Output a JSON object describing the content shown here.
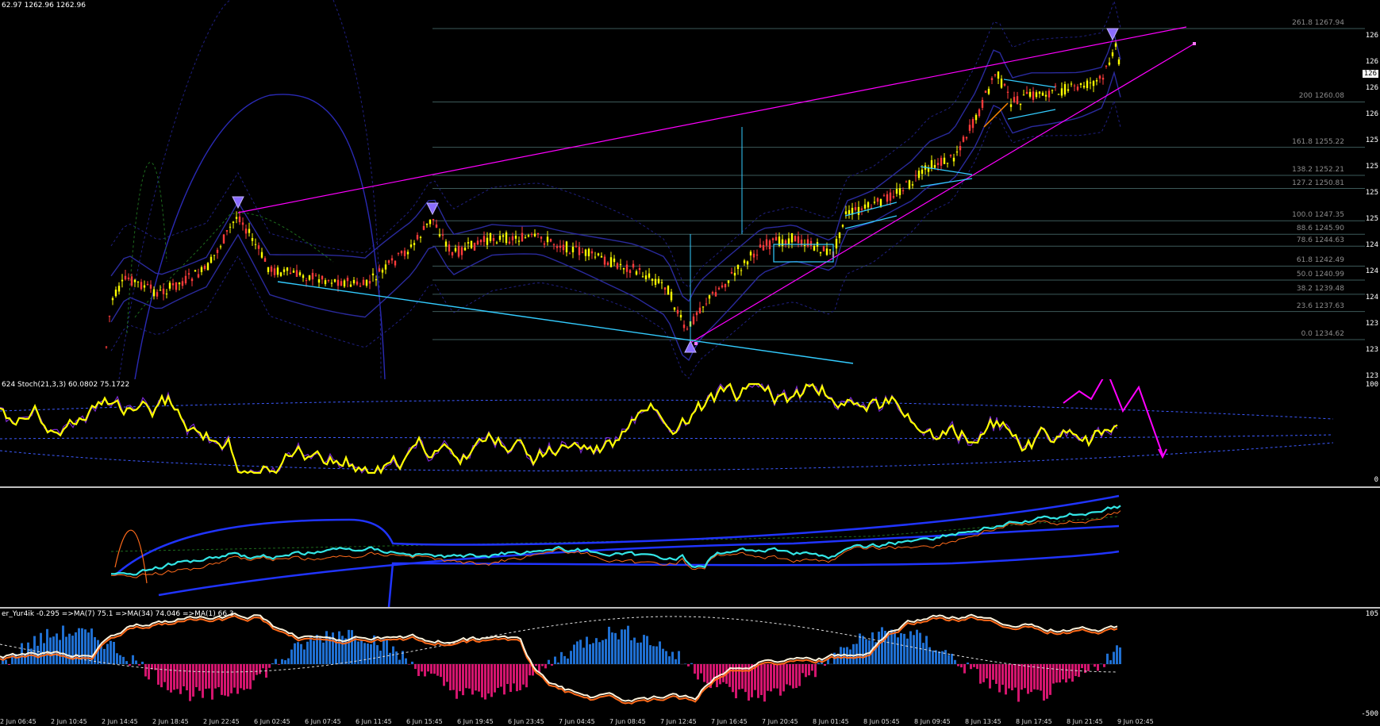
{
  "main": {
    "ohlc": "62.97 1262.96 1262.96",
    "price_axis": [
      "126",
      "126",
      "126",
      "126",
      "125",
      "125",
      "125",
      "125",
      "124",
      "124",
      "124",
      "123",
      "123",
      "123",
      "123"
    ],
    "current_price": "126",
    "fib_levels": [
      {
        "label": "261.8 1267.94",
        "price": 1267.94
      },
      {
        "label": "200 1260.08",
        "price": 1260.08
      },
      {
        "label": "161.8 1255.22",
        "price": 1255.22
      },
      {
        "label": "138.2 1252.21",
        "price": 1252.21
      },
      {
        "label": "127.2 1250.81",
        "price": 1250.81
      },
      {
        "label": "100.0 1247.35",
        "price": 1247.35
      },
      {
        "label": "88.6 1245.90",
        "price": 1245.9
      },
      {
        "label": "78.6 1244.63",
        "price": 1244.63
      },
      {
        "label": "61.8 1242.49",
        "price": 1242.49
      },
      {
        "label": "50.0 1240.99",
        "price": 1240.99
      },
      {
        "label": "38.2 1239.48",
        "price": 1239.48
      },
      {
        "label": "23.6 1237.63",
        "price": 1237.63
      },
      {
        "label": "0.0 1234.62",
        "price": 1234.62
      }
    ]
  },
  "stoch": {
    "title": "624 Stoch(21,3,3) 60.0802 75.1722",
    "axis_top": "100",
    "axis_bottom": "0"
  },
  "hist": {
    "title": "er_Yur4ik -0.295 =>MA(7) 75.1 =>MA(34) 74.046 =>MA(1) 66.3",
    "axis_top": "105",
    "axis_bottom": "-500"
  },
  "time_axis": [
    "2 Jun 06:45",
    "2 Jun 10:45",
    "2 Jun 14:45",
    "2 Jun 18:45",
    "2 Jun 22:45",
    "6 Jun 02:45",
    "6 Jun 07:45",
    "6 Jun 11:45",
    "6 Jun 15:45",
    "6 Jun 19:45",
    "6 Jun 23:45",
    "7 Jun 04:45",
    "7 Jun 08:45",
    "7 Jun 12:45",
    "7 Jun 16:45",
    "7 Jun 20:45",
    "8 Jun 01:45",
    "8 Jun 05:45",
    "8 Jun 09:45",
    "8 Jun 13:45",
    "8 Jun 17:45",
    "8 Jun 21:45",
    "9 Jun 02:45"
  ],
  "colors": {
    "bull_candle": "#ffff00",
    "bear_candle": "#ff3b3b",
    "trendline_magenta": "#ff00ff",
    "trendline_cyan": "#33ccff",
    "envelope_blue": "#2a2ab5",
    "stoch_main": "#ffff00",
    "stoch_signal": "#7a2ad0",
    "hist_positive": "#1f6fd1",
    "hist_negative": "#d4156e",
    "cyan_line": "#33e6e6"
  }
}
